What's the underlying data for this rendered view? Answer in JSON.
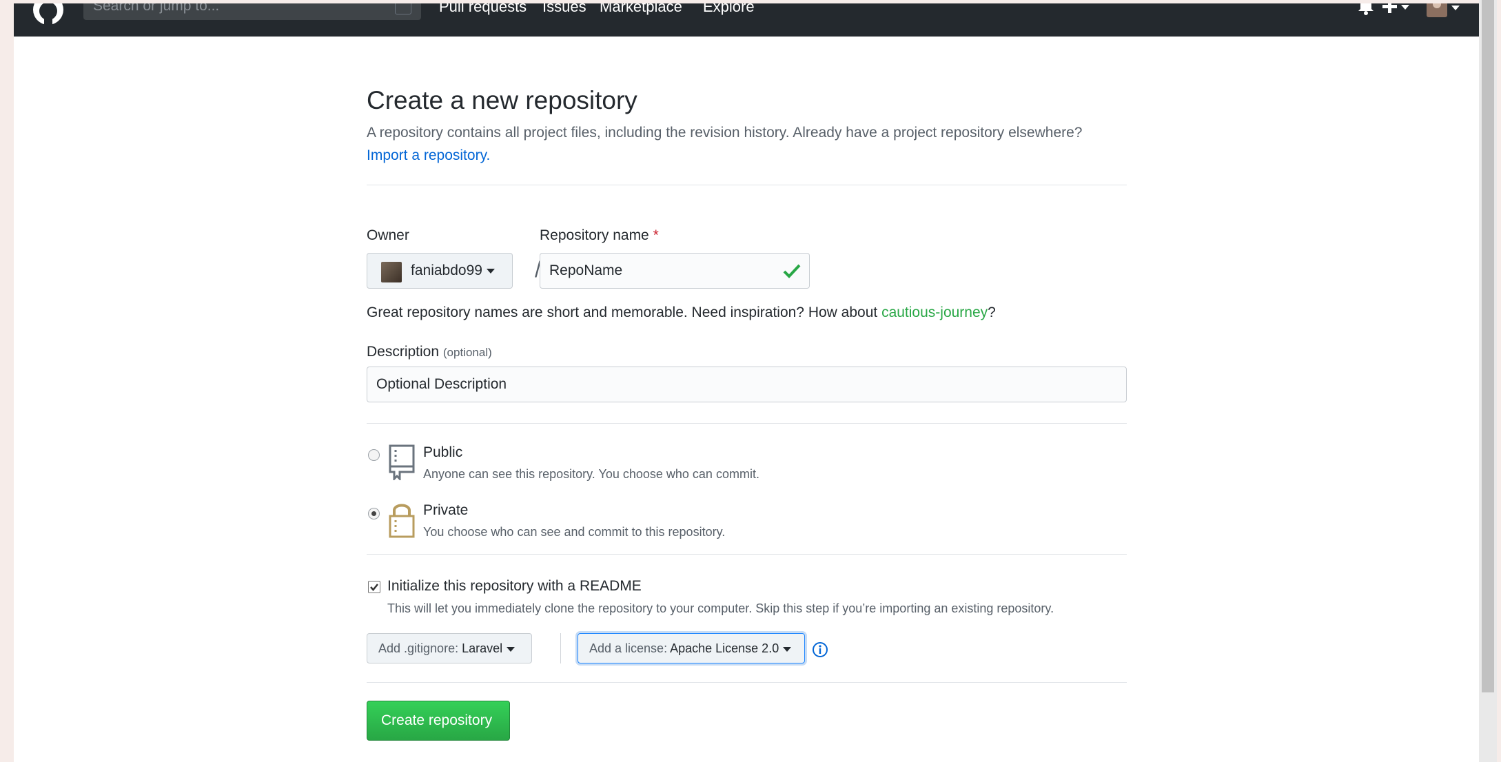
{
  "header": {
    "search_placeholder": "Search or jump to...",
    "nav": [
      "Pull requests",
      "Issues",
      "Marketplace",
      "Explore"
    ]
  },
  "page": {
    "title": "Create a new repository",
    "subtitle": "A repository contains all project files, including the revision history. Already have a project repository elsewhere?",
    "import_link": "Import a repository."
  },
  "form": {
    "owner_label": "Owner",
    "owner_value": "faniabdo99",
    "repo_name_label": "Repository name",
    "required_mark": "*",
    "repo_name_value": "RepoName",
    "hint_prefix": "Great repository names are short and memorable. Need inspiration? How about ",
    "hint_suggestion": "cautious-journey",
    "hint_suffix": "?",
    "description_label": "Description",
    "description_optional": "(optional)",
    "description_value": "Optional Description",
    "visibility": [
      {
        "title": "Public",
        "desc": "Anyone can see this repository. You choose who can commit.",
        "checked": false
      },
      {
        "title": "Private",
        "desc": "You choose who can see and commit to this repository.",
        "checked": true
      }
    ],
    "readme_label": "Initialize this repository with a README",
    "readme_checked": true,
    "readme_desc": "This will let you immediately clone the repository to your computer. Skip this step if you’re importing an existing repository.",
    "gitignore_prefix": "Add .gitignore:",
    "gitignore_value": "Laravel",
    "license_prefix": "Add a license:",
    "license_value": "Apache License 2.0",
    "submit_label": "Create repository"
  },
  "colors": {
    "header_bg": "#24292e",
    "link": "#0366d6",
    "suggestion": "#28a745",
    "primary_button": "#28a745"
  }
}
